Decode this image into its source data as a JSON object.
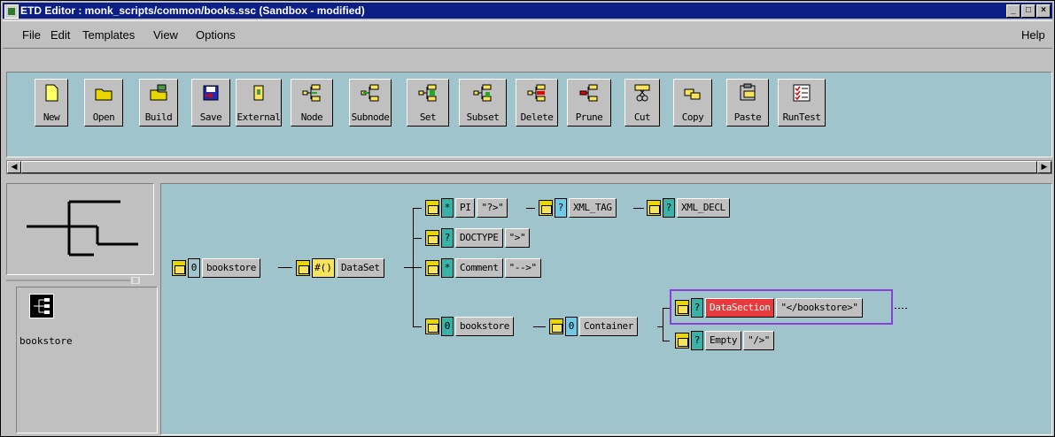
{
  "window": {
    "title": "ETD Editor : monk_scripts/common/books.ssc (Sandbox - modified)"
  },
  "menu": {
    "file": "File",
    "edit": "Edit",
    "templates": "Templates",
    "view": "View",
    "options": "Options",
    "help": "Help"
  },
  "toolbar": {
    "buttons": [
      {
        "label": "New",
        "icon": "new-icon"
      },
      {
        "label": "Open",
        "icon": "open-icon"
      },
      {
        "label": "Build",
        "icon": "build-icon"
      },
      {
        "label": "Save",
        "icon": "save-icon"
      },
      {
        "label": "External",
        "icon": "external-icon"
      },
      {
        "label": "Node",
        "icon": "node-icon"
      },
      {
        "label": "Subnode",
        "icon": "subnode-icon"
      },
      {
        "label": "Set",
        "icon": "set-icon"
      },
      {
        "label": "Subset",
        "icon": "subset-icon"
      },
      {
        "label": "Delete",
        "icon": "delete-icon"
      },
      {
        "label": "Prune",
        "icon": "prune-icon"
      },
      {
        "label": "Cut",
        "icon": "cut-icon"
      },
      {
        "label": "Copy",
        "icon": "copy-icon"
      },
      {
        "label": "Paste",
        "icon": "paste-icon"
      },
      {
        "label": "RunTest",
        "icon": "runtest-icon"
      }
    ]
  },
  "palette": {
    "item_label": "bookstore"
  },
  "tree": {
    "root": {
      "card": "0",
      "name": "bookstore"
    },
    "dataset": {
      "card": "#()",
      "name": "DataSet"
    },
    "pi": {
      "card": "*",
      "name": "PI",
      "value": "\"?>\""
    },
    "xml_tag": {
      "card": "?",
      "name": "XML_TAG"
    },
    "xml_decl": {
      "card": "?",
      "name": "XML_DECL"
    },
    "doctype": {
      "card": "?",
      "name": "DOCTYPE",
      "value": "\">\""
    },
    "comment": {
      "card": "*",
      "name": "Comment",
      "value": "\"-->\""
    },
    "bookstore2": {
      "card": "0",
      "name": "bookstore"
    },
    "container": {
      "card": "0",
      "name": "Container"
    },
    "datasection": {
      "card": "?",
      "name": "DataSection",
      "value": "\"</bookstore>\""
    },
    "empty": {
      "card": "?",
      "name": "Empty",
      "value": "\"/>\""
    }
  }
}
